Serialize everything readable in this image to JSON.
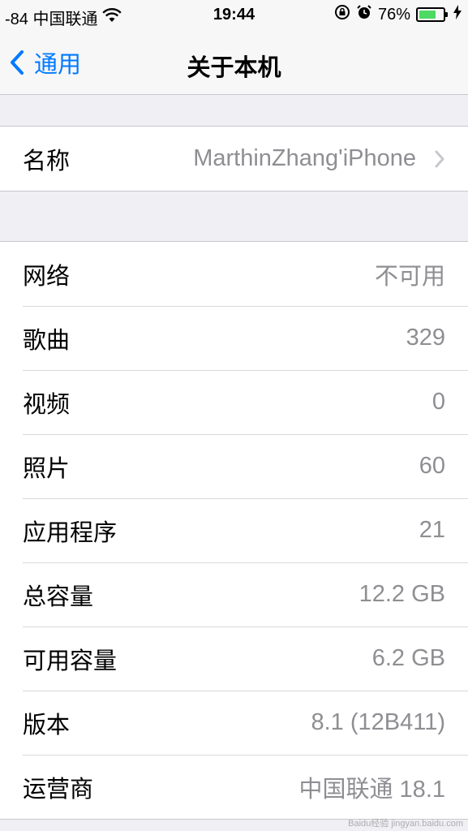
{
  "status_bar": {
    "carrier": "-84 中国联通",
    "time": "19:44",
    "battery_percent": "76%",
    "battery_level": 0.76,
    "battery_color": "#4cd964",
    "icons": [
      "wifi-icon",
      "rotation-lock-icon",
      "alarm-icon",
      "battery-icon",
      "charging-bolt-icon"
    ]
  },
  "nav": {
    "back_label": "通用",
    "title": "关于本机",
    "accent": "#007aff"
  },
  "name_row": {
    "label": "名称",
    "value": "MarthinZhang'iPhone"
  },
  "info_rows": [
    {
      "label": "网络",
      "value": "不可用"
    },
    {
      "label": "歌曲",
      "value": "329"
    },
    {
      "label": "视频",
      "value": "0"
    },
    {
      "label": "照片",
      "value": "60"
    },
    {
      "label": "应用程序",
      "value": "21"
    },
    {
      "label": "总容量",
      "value": "12.2 GB"
    },
    {
      "label": "可用容量",
      "value": "6.2 GB"
    },
    {
      "label": "版本",
      "value": "8.1 (12B411)"
    },
    {
      "label": "运营商",
      "value": "中国联通 18.1"
    }
  ],
  "watermark": "Baidu经验 jingyan.baidu.com"
}
